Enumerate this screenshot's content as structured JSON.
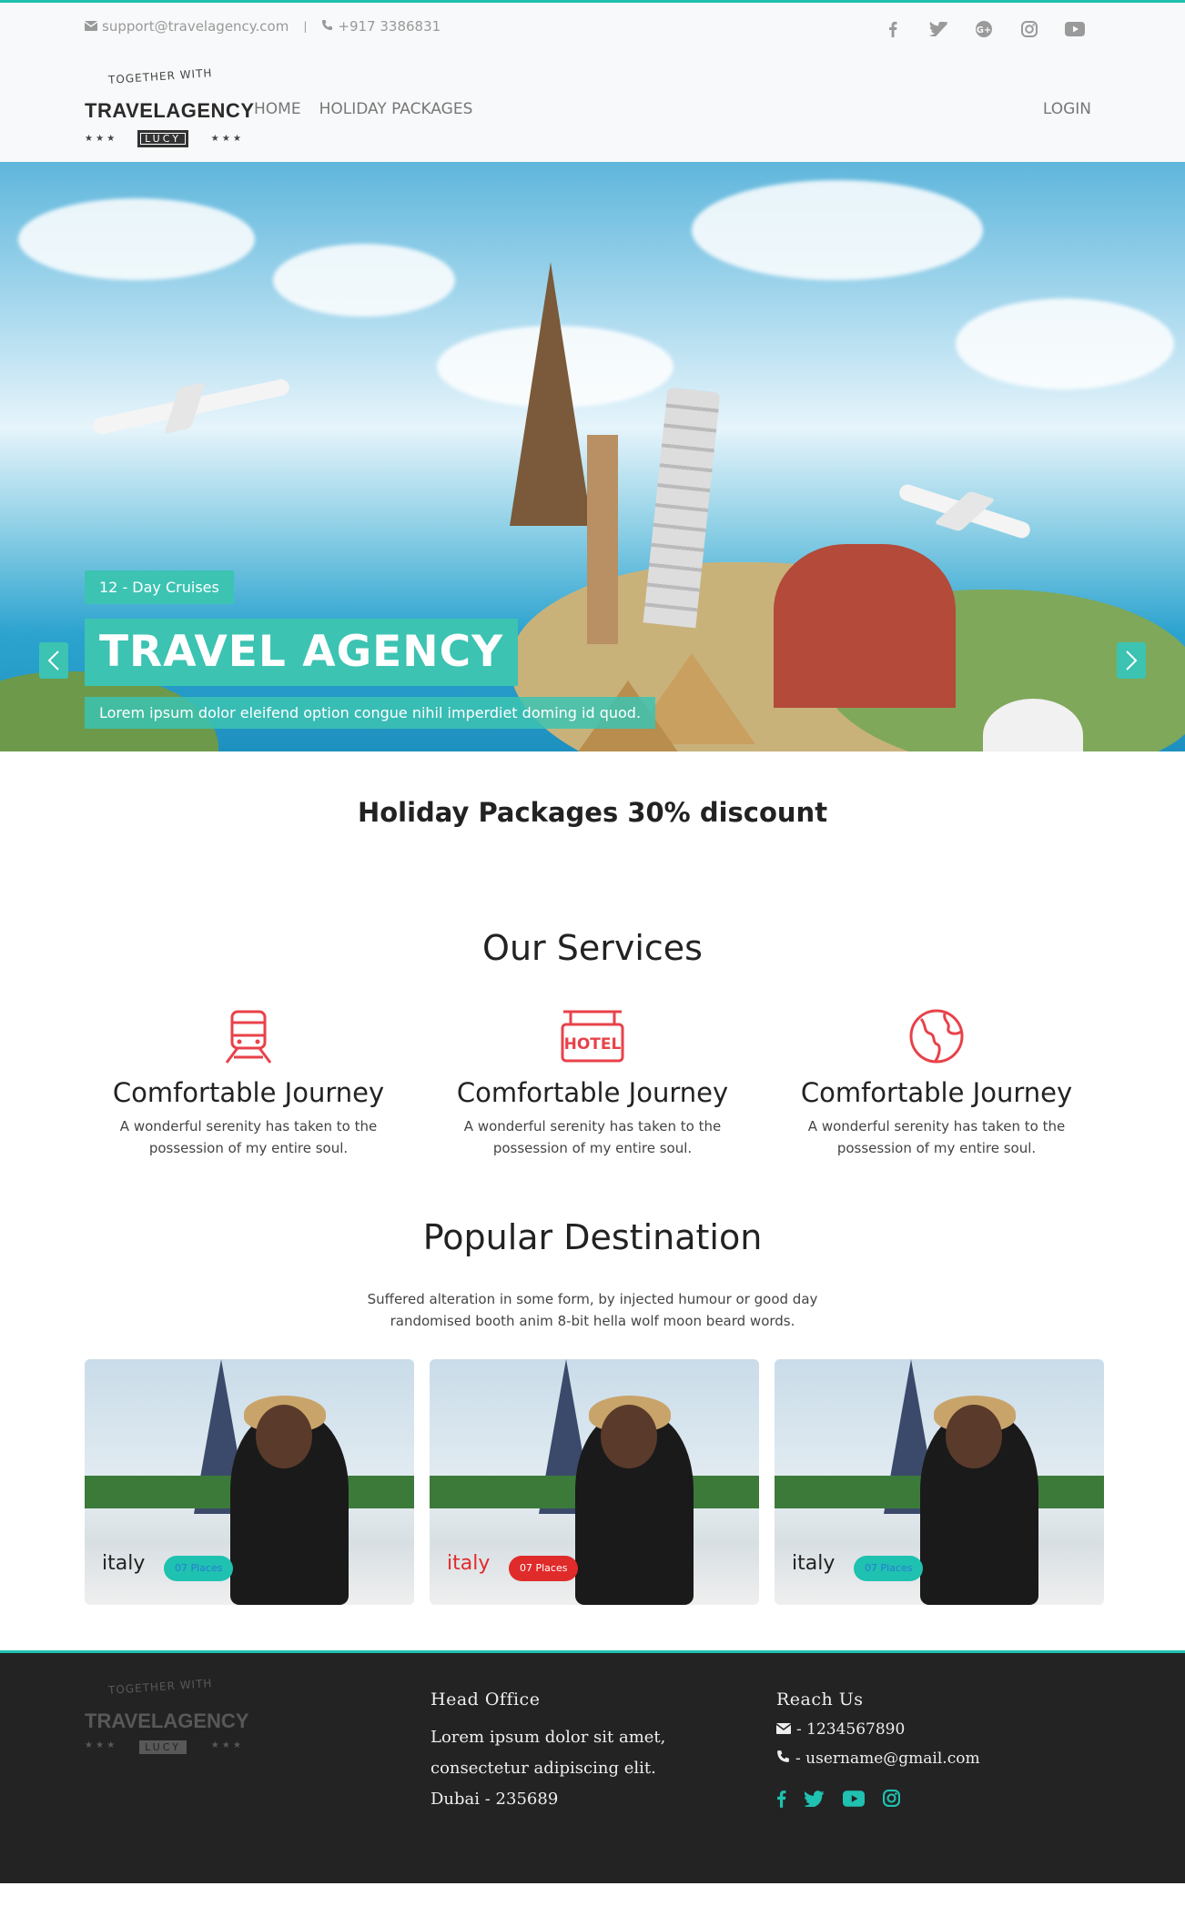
{
  "topbar": {
    "email": "support@travelagency.com",
    "phone": "+917 3386831",
    "social_icons": [
      "facebook-icon",
      "twitter-icon",
      "google-plus-icon",
      "instagram-icon",
      "youtube-icon"
    ]
  },
  "logo": {
    "tagline": "TOGETHER WITH",
    "name": "TRAVELAGENCY",
    "badge": "LUCY",
    "stars_left": "★ ★ ★",
    "stars_right": "★ ★ ★"
  },
  "nav": {
    "links": [
      "HOME",
      "HOLIDAY PACKAGES"
    ],
    "login": "LOGIN"
  },
  "hero": {
    "tag": "12 - Day Cruises",
    "title": "TRAVEL AGENCY",
    "text": "Lorem ipsum dolor eleifend option congue nihil imperdiet doming id quod."
  },
  "discount": "Holiday Packages 30% discount",
  "services": {
    "title": "Our Services",
    "items": [
      {
        "icon": "train-icon",
        "title": "Comfortable Journey",
        "text": "A wonderful serenity has taken to the possession of my entire soul."
      },
      {
        "icon": "hotel-icon",
        "title": "Comfortable Journey",
        "text": "A wonderful serenity has taken to the possession of my entire soul."
      },
      {
        "icon": "globe-icon",
        "title": "Comfortable Journey",
        "text": "A wonderful serenity has taken to the possession of my entire soul."
      }
    ]
  },
  "destinations": {
    "title": "Popular Destination",
    "subtitle": "Suffered alteration in some form, by injected humour or good day randomised booth anim 8-bit hella wolf moon beard words.",
    "cards": [
      {
        "name": "italy",
        "places": "07 Places",
        "highlight": false
      },
      {
        "name": "italy",
        "places": "07 Places",
        "highlight": true
      },
      {
        "name": "italy",
        "places": "07 Places",
        "highlight": false
      }
    ]
  },
  "footer": {
    "office_title": "Head Office",
    "office_lines": [
      "Lorem ipsum dolor sit amet,",
      "consectetur adipiscing elit.",
      "Dubai - 235689"
    ],
    "reach_title": "Reach Us",
    "phone": " - 1234567890",
    "email": " - username@gmail.com",
    "social_icons": [
      "facebook-icon",
      "twitter-icon",
      "youtube-icon",
      "instagram-icon"
    ]
  },
  "colors": {
    "accent": "#1fc1b0",
    "hero_accent": "#3cc3b2",
    "icon_red": "#e8424a",
    "footer_bg": "#232323"
  }
}
